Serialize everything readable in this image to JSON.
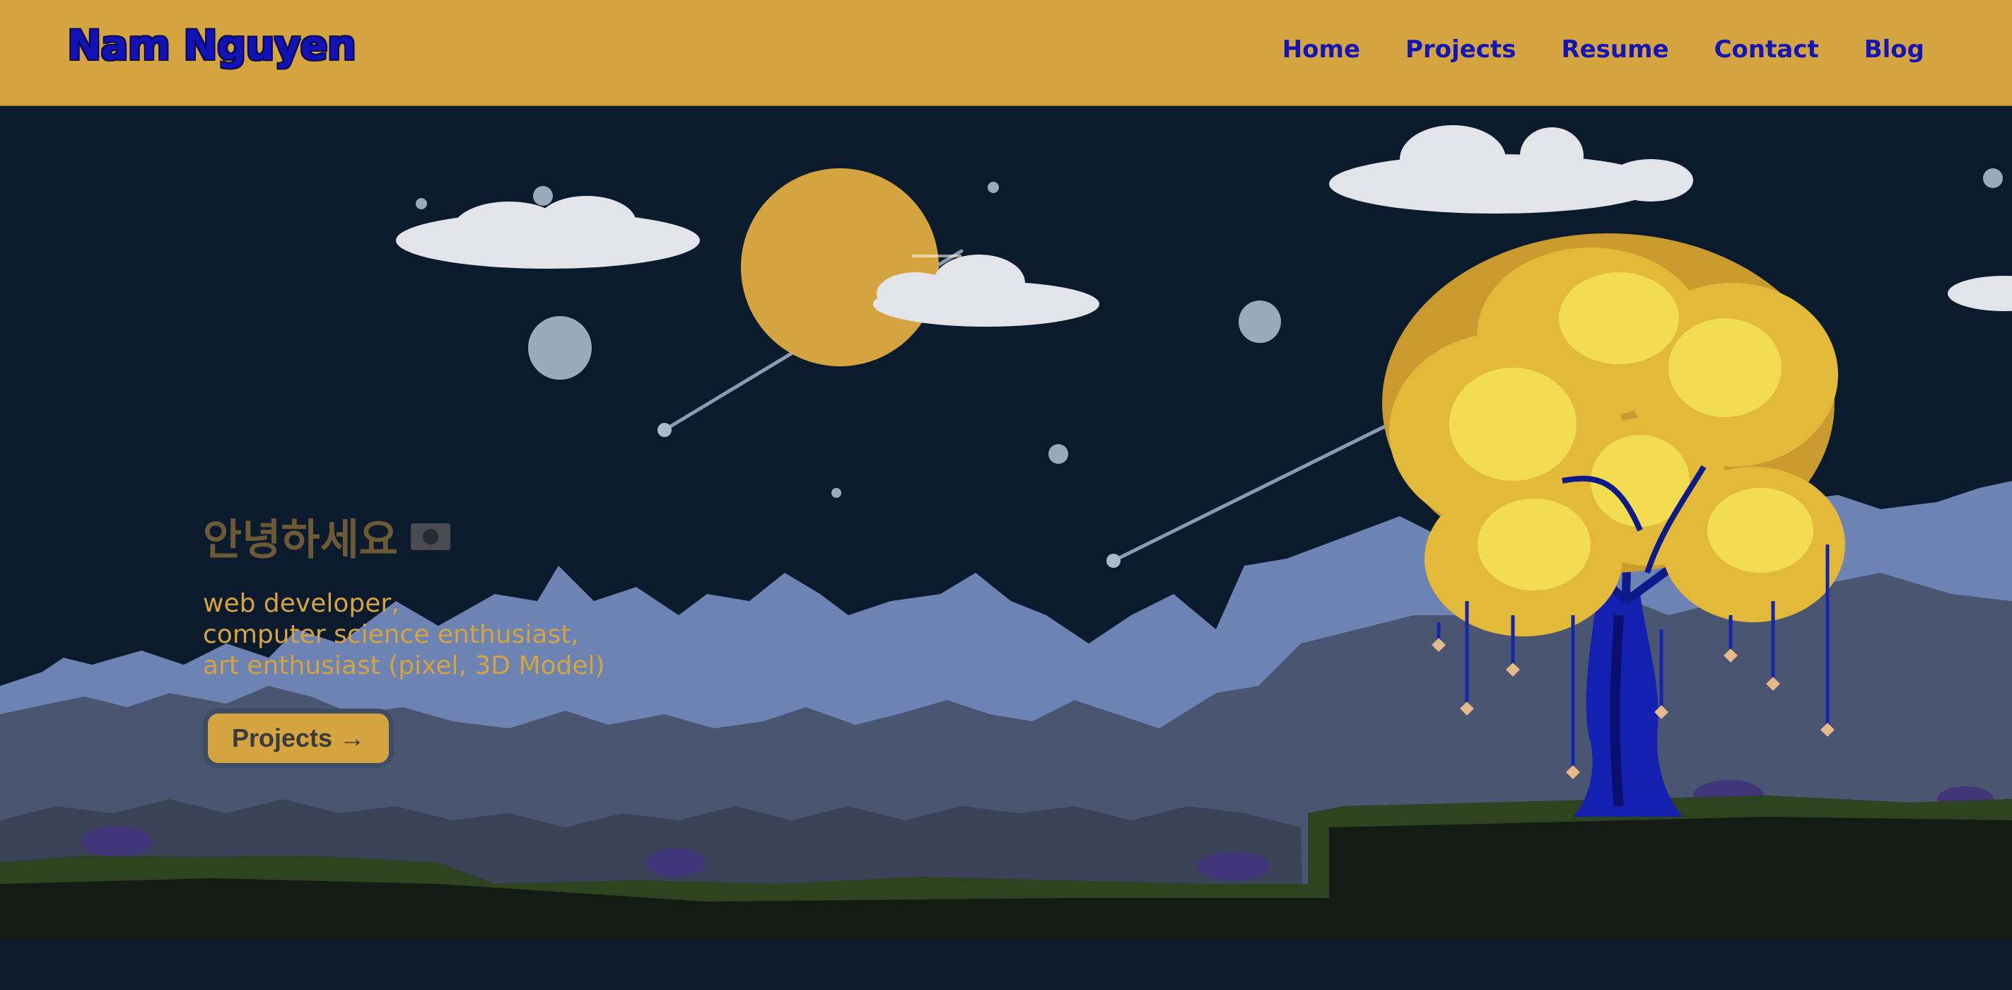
{
  "header": {
    "brand": "Nam Nguyen",
    "nav": [
      {
        "label": "Home"
      },
      {
        "label": "Projects"
      },
      {
        "label": "Resume"
      },
      {
        "label": "Contact"
      },
      {
        "label": "Blog"
      }
    ]
  },
  "hero": {
    "greeting": "안녕하세요",
    "flag_icon": "south-korea-flag-icon",
    "tagline_lines": [
      "web developer,",
      "computer science enthusiast,",
      "art enthusiast (pixel, 3D Model)"
    ],
    "cta_label": "Projects →"
  },
  "colors": {
    "header_bg": "#d3a440",
    "nav_text": "#1515b5",
    "sky": "#0b1a2c",
    "moon": "#d3a440",
    "accent_gold": "#d3a440"
  }
}
